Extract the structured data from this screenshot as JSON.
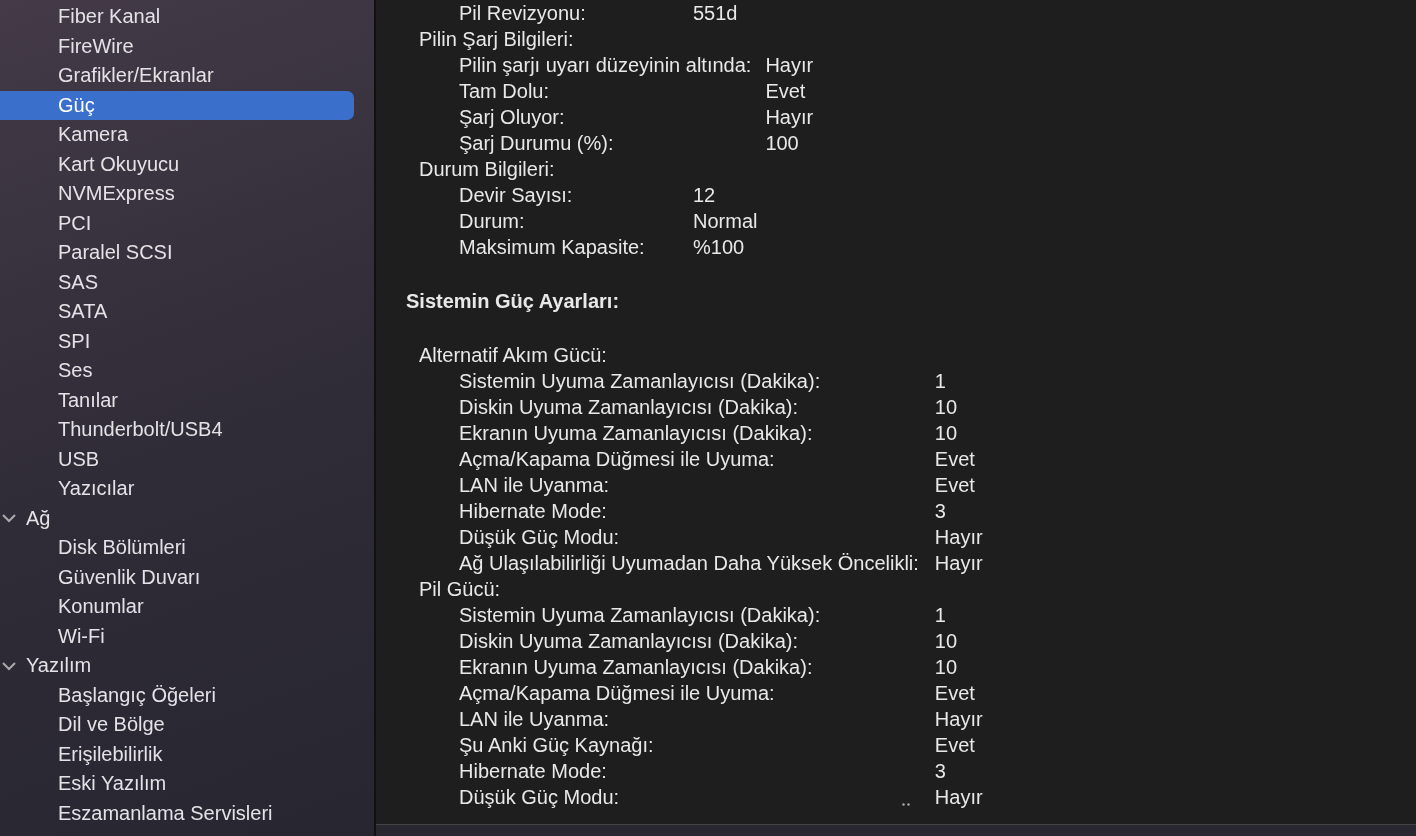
{
  "sidebar": {
    "items": [
      {
        "label": "Fiber Kanal",
        "selected": false
      },
      {
        "label": "FireWire",
        "selected": false
      },
      {
        "label": "Grafikler/Ekranlar",
        "selected": false
      },
      {
        "label": "Güç",
        "selected": true
      },
      {
        "label": "Kamera",
        "selected": false
      },
      {
        "label": "Kart Okuyucu",
        "selected": false
      },
      {
        "label": "NVMExpress",
        "selected": false
      },
      {
        "label": "PCI",
        "selected": false
      },
      {
        "label": "Paralel SCSI",
        "selected": false
      },
      {
        "label": "SAS",
        "selected": false
      },
      {
        "label": "SATA",
        "selected": false
      },
      {
        "label": "SPI",
        "selected": false
      },
      {
        "label": "Ses",
        "selected": false
      },
      {
        "label": "Tanılar",
        "selected": false
      },
      {
        "label": "Thunderbolt/USB4",
        "selected": false
      },
      {
        "label": "USB",
        "selected": false
      },
      {
        "label": "Yazıcılar",
        "selected": false
      },
      {
        "label": "Ağ",
        "expanded": true,
        "children": [
          {
            "label": "Disk Bölümleri",
            "selected": false
          },
          {
            "label": "Güvenlik Duvarı",
            "selected": false
          },
          {
            "label": "Konumlar",
            "selected": false
          },
          {
            "label": "Wi-Fi",
            "selected": false
          }
        ]
      },
      {
        "label": "Yazılım",
        "expanded": true,
        "children": [
          {
            "label": "Başlangıç Öğeleri",
            "selected": false
          },
          {
            "label": "Dil ve Bölge",
            "selected": false
          },
          {
            "label": "Erişilebilirlik",
            "selected": false
          },
          {
            "label": "Eski Yazılım",
            "selected": false
          },
          {
            "label": "Eszamanlama Servisleri",
            "selected": false
          }
        ]
      }
    ]
  },
  "content": {
    "sections": [
      {
        "kind": "per-group",
        "groups": [
          {
            "rows": [
              {
                "label": "Pil Revizyonu:",
                "value": "551d"
              }
            ]
          },
          {
            "title": "Pilin Şarj Bilgileri:",
            "rows": [
              {
                "label": "Pilin şarjı uyarı düzeyinin altında:",
                "value": "Hayır"
              },
              {
                "label": "Tam Dolu:",
                "value": "Evet"
              },
              {
                "label": "Şarj Oluyor:",
                "value": "Hayır"
              },
              {
                "label": "Şarj Durumu (%):",
                "value": "100"
              }
            ]
          },
          {
            "title": "Durum Bilgileri:",
            "rows": [
              {
                "label": "Devir Sayısı:",
                "value": "12"
              },
              {
                "label": "Durum:",
                "value": "Normal"
              },
              {
                "label": "Maksimum Kapasite:",
                "value": "%100"
              }
            ]
          }
        ]
      },
      {
        "kind": "shared",
        "heading": "Sistemin Güç Ayarları:",
        "groups": [
          {
            "title": "Alternatif Akım Gücü:",
            "rows": [
              {
                "label": "Sistemin Uyuma Zamanlayıcısı (Dakika):",
                "value": "1"
              },
              {
                "label": "Diskin Uyuma Zamanlayıcısı (Dakika):",
                "value": "10"
              },
              {
                "label": "Ekranın Uyuma Zamanlayıcısı (Dakika):",
                "value": "10"
              },
              {
                "label": "Açma/Kapama Düğmesi ile Uyuma:",
                "value": "Evet"
              },
              {
                "label": "LAN ile Uyanma:",
                "value": "Evet"
              },
              {
                "label": "Hibernate Mode:",
                "value": "3"
              },
              {
                "label": "Düşük Güç Modu:",
                "value": "Hayır"
              },
              {
                "label": "Ağ Ulaşılabilirliği Uyumadan Daha Yüksek Öncelikli:",
                "value": "Hayır"
              }
            ]
          },
          {
            "title": "Pil Gücü:",
            "rows": [
              {
                "label": "Sistemin Uyuma Zamanlayıcısı (Dakika):",
                "value": "1"
              },
              {
                "label": "Diskin Uyuma Zamanlayıcısı (Dakika):",
                "value": "10"
              },
              {
                "label": "Ekranın Uyuma Zamanlayıcısı (Dakika):",
                "value": "10"
              },
              {
                "label": "Açma/Kapama Düğmesi ile Uyuma:",
                "value": "Evet"
              },
              {
                "label": "LAN ile Uyanma:",
                "value": "Hayır"
              },
              {
                "label": "Şu Anki Güç Kaynağı:",
                "value": "Evet"
              },
              {
                "label": "Hibernate Mode:",
                "value": "3"
              },
              {
                "label": "Düşük Güç Modu:",
                "value": "Hayır"
              }
            ]
          }
        ]
      }
    ]
  }
}
